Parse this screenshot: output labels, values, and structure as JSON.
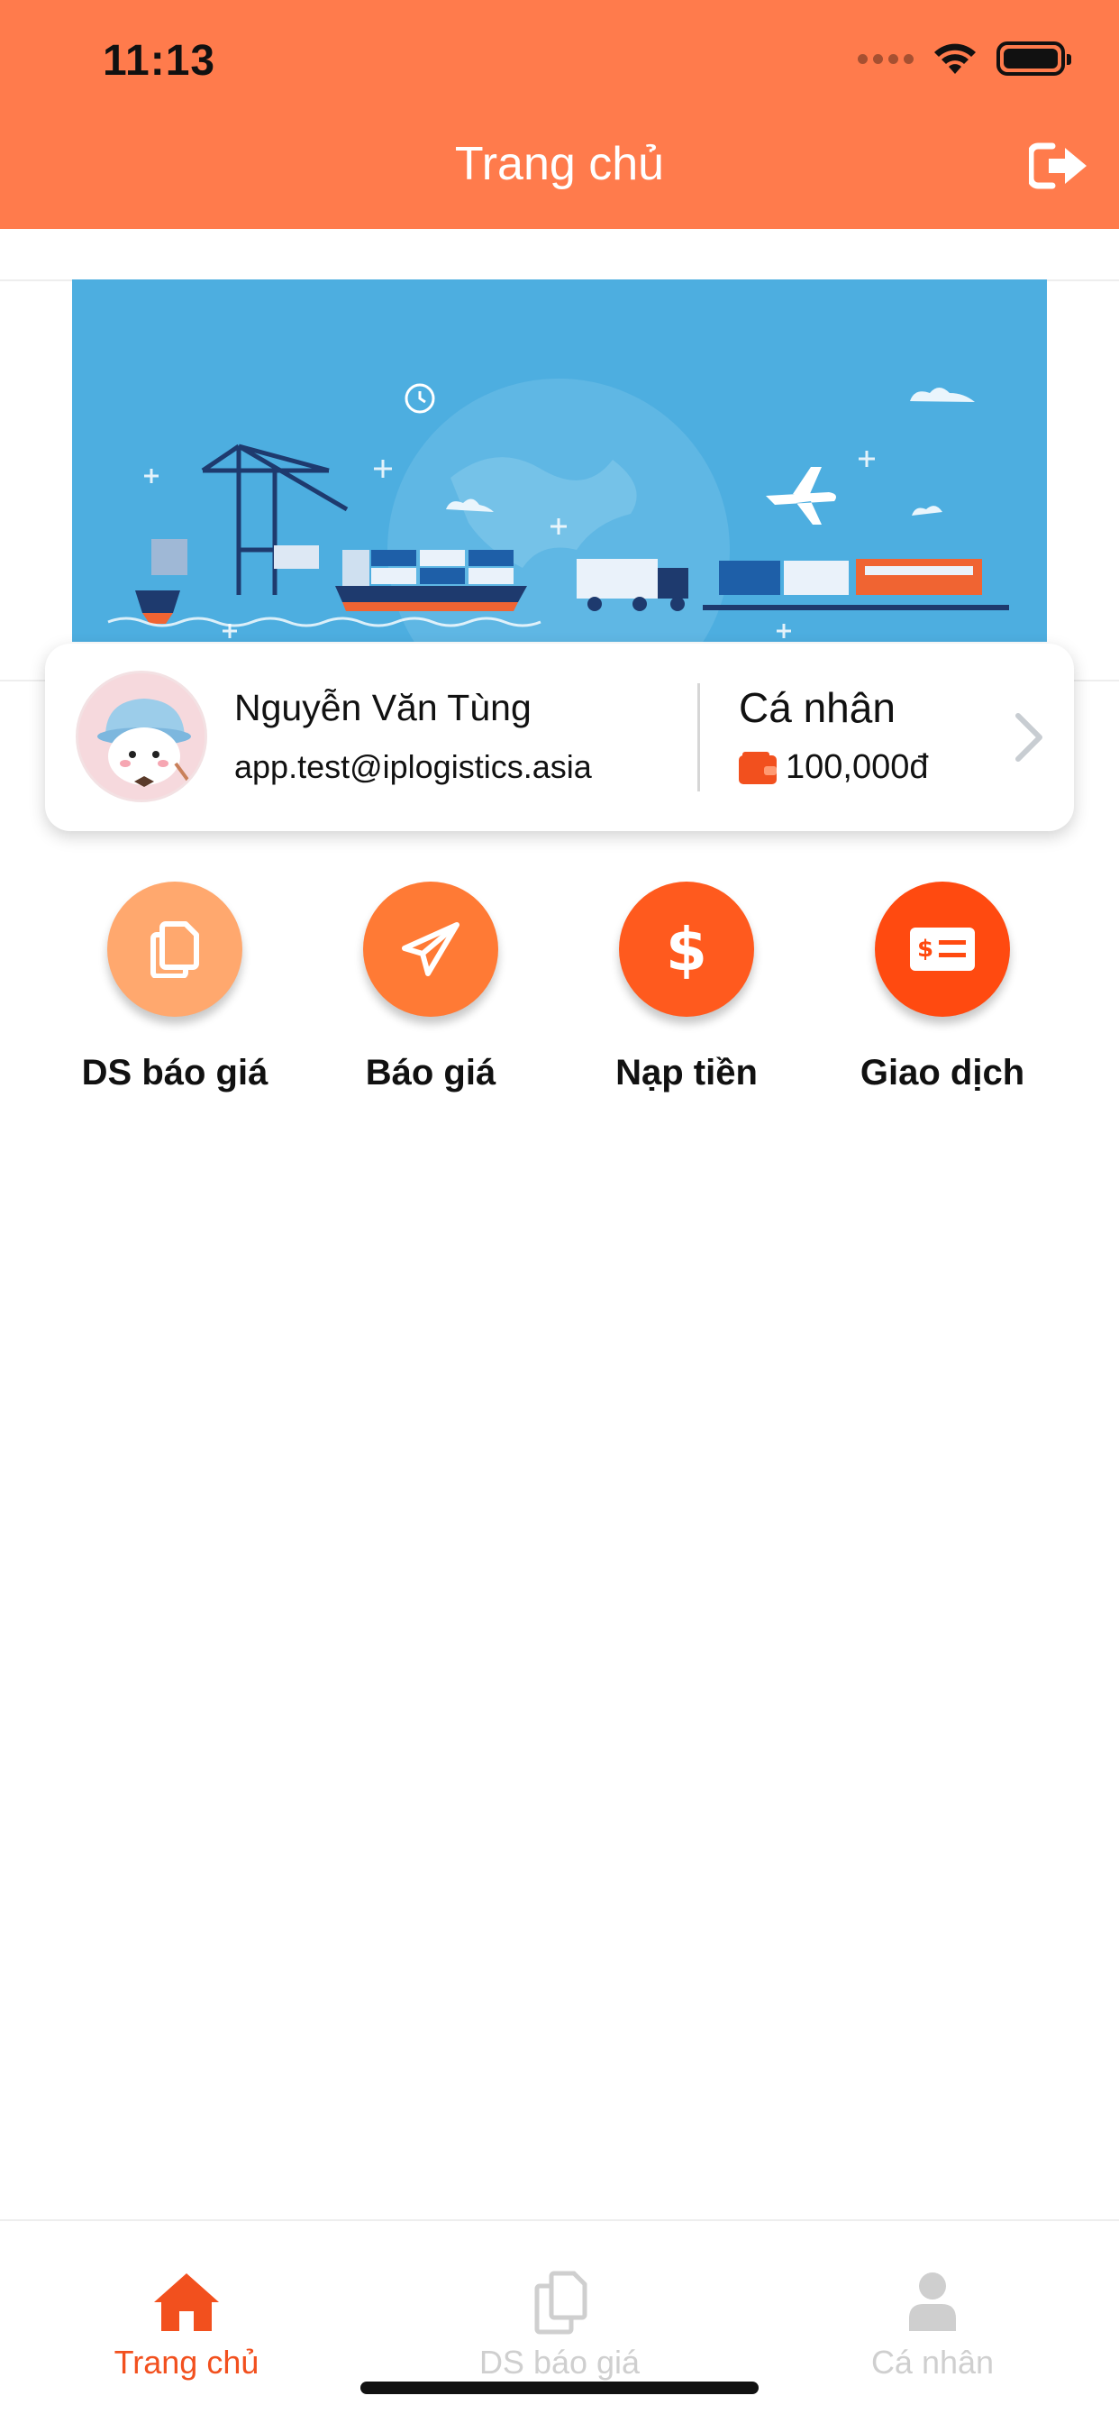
{
  "status_bar": {
    "time": "11:13"
  },
  "header": {
    "title": "Trang chủ"
  },
  "profile": {
    "name": "Nguyễn Văn Tùng",
    "email": "app.test@iplogistics.asia",
    "account_type": "Cá nhân",
    "balance": "100,000đ"
  },
  "actions": [
    {
      "label": "DS báo giá",
      "icon": "documents-icon",
      "color": "#FFA86E"
    },
    {
      "label": "Báo giá",
      "icon": "paper-plane-icon",
      "color": "#FF7A35"
    },
    {
      "label": "Nạp tiền",
      "icon": "dollar-icon",
      "color": "#FF5A1E"
    },
    {
      "label": "Giao dịch",
      "icon": "bill-icon",
      "color": "#FF4A10"
    }
  ],
  "tabbar": {
    "items": [
      {
        "label": "Trang chủ",
        "icon": "home-icon",
        "active": true
      },
      {
        "label": "DS báo giá",
        "icon": "documents-icon",
        "active": false
      },
      {
        "label": "Cá nhân",
        "icon": "user-icon",
        "active": false
      }
    ]
  },
  "colors": {
    "primary": "#FF7B4C",
    "active_tab": "#F2501E",
    "inactive_tab": "#CFCFCF",
    "banner": "#4DAEE0"
  }
}
